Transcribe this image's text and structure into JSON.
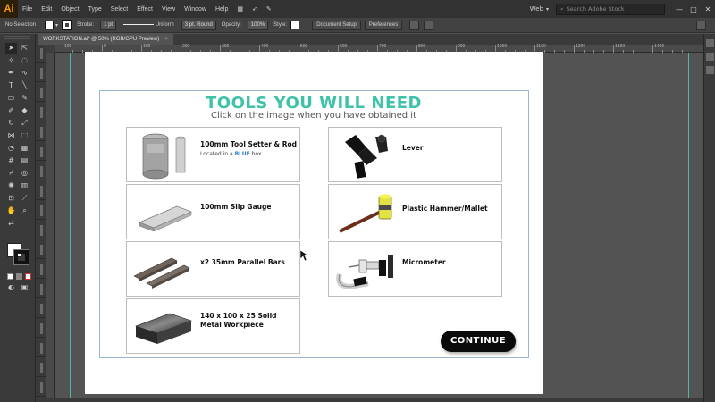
{
  "app": {
    "logo": "Ai",
    "menu": [
      "File",
      "Edit",
      "Object",
      "Type",
      "Select",
      "Effect",
      "View",
      "Window",
      "Help"
    ],
    "workspace": "Web",
    "stock_search_placeholder": "Search Adobe Stock",
    "window_buttons": [
      "—",
      "□",
      "✕"
    ]
  },
  "controlbar": {
    "selection": "No Selection",
    "stroke_label": "Stroke:",
    "stroke_value": "1 pt",
    "stroke_profile": "Uniform",
    "brush": "3 pt. Round",
    "opacity_label": "Opacity:",
    "opacity_value": "100%",
    "style_label": "Style:",
    "document_setup": "Document Setup",
    "preferences": "Preferences"
  },
  "document": {
    "tab_title": "WORKSTATION.ai* @ 50% (RGB/GPU Preview)",
    "tab_close": "×"
  },
  "ruler": {
    "h_numbers": [
      "100",
      "0",
      "100",
      "200",
      "300",
      "400",
      "500",
      "600",
      "700",
      "800",
      "900",
      "1000",
      "1100",
      "1200",
      "1300",
      "1400"
    ]
  },
  "page": {
    "title": "TOOLS YOU WILL NEED",
    "subtitle": "Click on the image when you have obtained it",
    "continue_label": "CONTINUE",
    "cards": {
      "tool_setter": {
        "label": "100mm Tool Setter & Rod",
        "note_prefix": "Located in a ",
        "note_highlight": "BLUE",
        "note_suffix": " box"
      },
      "slip_gauge": {
        "label": "100mm Slip Gauge"
      },
      "parallel_bars": {
        "label": "x2 35mm Parallel Bars"
      },
      "workpiece": {
        "label_line1": "140 x 100 x 25 Solid",
        "label_line2": "Metal Workpiece"
      },
      "lever": {
        "label": "Lever"
      },
      "hammer": {
        "label": "Plastic Hammer/Mallet"
      },
      "micrometer": {
        "label": "Micrometer"
      }
    }
  },
  "colors": {
    "accent_title": "#3fc2a8",
    "highlight_blue": "#2a7ac9",
    "guide": "#4fd1c1",
    "continue_bg": "#0a0a0a"
  }
}
